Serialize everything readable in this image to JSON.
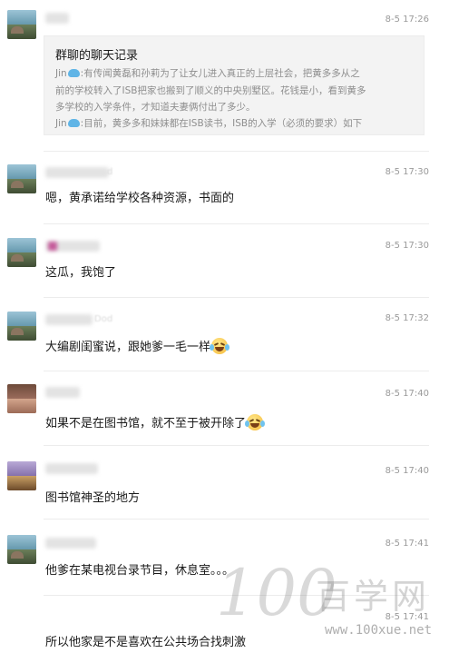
{
  "messages": [
    {
      "time": "8-5 17:26",
      "record": {
        "title": "群聊的聊天记录",
        "lines": [
          {
            "sender": "Jin",
            "text": ":有传闻黄磊和孙莉为了让女儿进入真正的上层社会，把黄多多从之"
          },
          {
            "sender": "",
            "text": "前的学校转入了ISB把家也搬到了顺义的中央别墅区。花钱是小，看到黄多"
          },
          {
            "sender": "",
            "text": "多学校的入学条件，才知道夫妻俩付出了多少。"
          },
          {
            "sender": "Jin",
            "text": ":目前，黄多多和妹妹都在ISB读书，ISB的入学（必须的要求）如下"
          }
        ]
      }
    },
    {
      "time": "8-5 17:30",
      "name_fragment": "d",
      "text": "嗯，黄承诺给学校各种资源，书面的"
    },
    {
      "time": "8-5 17:30",
      "text": "这瓜，我饱了"
    },
    {
      "time": "8-5 17:32",
      "name_fragment": "Dod",
      "text": "大编剧闺蜜说，跟她爹一毛一样"
    },
    {
      "time": "8-5 17:40",
      "text": "如果不是在图书馆，就不至于被开除了"
    },
    {
      "time": "8-5 17:40",
      "text": "图书馆神圣的地方"
    },
    {
      "time": "8-5 17:41",
      "text": "他爹在某电视台录节目，休息室。。。"
    },
    {
      "time": "8-5 17:41",
      "text": "所以他家是不是喜欢在公共场合找刺激"
    }
  ],
  "watermark": {
    "logo_number": "100",
    "logo_text": "百学网",
    "url": "www.100xue.net"
  },
  "icons": {
    "emoji": "laugh-cry-emoji-icon",
    "whale": "whale-icon"
  },
  "colors": {
    "time": "#9a9a9a",
    "record_bg": "#f3f3f3",
    "divider": "#ececec"
  }
}
